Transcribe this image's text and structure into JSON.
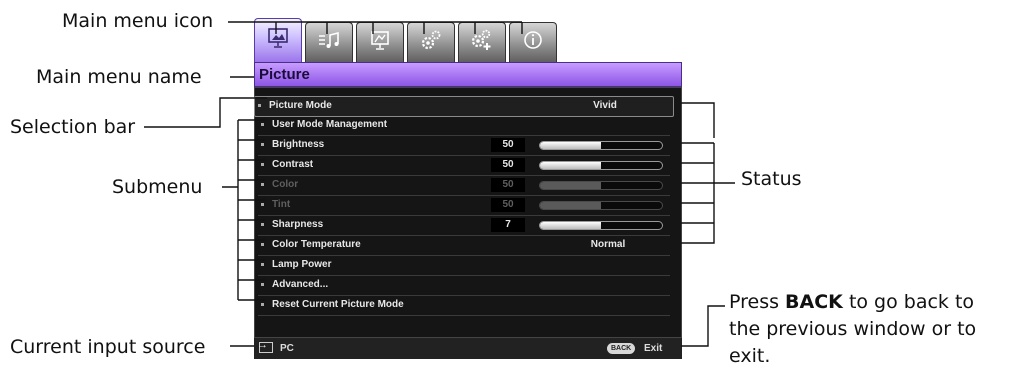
{
  "callouts": {
    "main_menu_icon": "Main menu icon",
    "main_menu_name": "Main menu name",
    "selection_bar": "Selection bar",
    "submenu": "Submenu",
    "status": "Status",
    "current_input_source": "Current input source",
    "back_prefix": "Press ",
    "back_key": "BACK",
    "back_line1_suffix": " to go back to",
    "back_line2": "the previous window or to",
    "back_line3": "exit."
  },
  "osd": {
    "tabs": [
      {
        "icon": "picture-icon",
        "active": true
      },
      {
        "icon": "audio-settings-icon",
        "active": false
      },
      {
        "icon": "display-icon",
        "active": false
      },
      {
        "icon": "system-setup-basic-icon",
        "active": false
      },
      {
        "icon": "system-setup-advanced-icon",
        "active": false
      },
      {
        "icon": "information-icon",
        "active": false
      }
    ],
    "menu_title": "Picture",
    "rows": [
      {
        "label": "Picture Mode",
        "value": "Vivid",
        "kind": "text",
        "selected": true
      },
      {
        "label": "User Mode Management",
        "kind": "none"
      },
      {
        "label": "Brightness",
        "value": "50",
        "level": 0.5,
        "kind": "slider"
      },
      {
        "label": "Contrast",
        "value": "50",
        "level": 0.5,
        "kind": "slider"
      },
      {
        "label": "Color",
        "value": "50",
        "level": 0.5,
        "kind": "slider",
        "disabled": true
      },
      {
        "label": "Tint",
        "value": "50",
        "level": 0.5,
        "kind": "slider",
        "disabled": true
      },
      {
        "label": "Sharpness",
        "value": "7",
        "level": 0.5,
        "kind": "slider"
      },
      {
        "label": "Color Temperature",
        "value": "Normal",
        "kind": "text"
      },
      {
        "label": "Lamp Power",
        "kind": "none"
      },
      {
        "label": "Advanced...",
        "kind": "none"
      },
      {
        "label": "Reset Current Picture Mode",
        "kind": "none"
      }
    ],
    "footer": {
      "source": "PC",
      "back_badge": "BACK",
      "exit": "Exit"
    }
  },
  "colors": {
    "tab_active": "#9a72ea",
    "title_bar": "#8d55e6",
    "panel_bg": "#151515"
  }
}
